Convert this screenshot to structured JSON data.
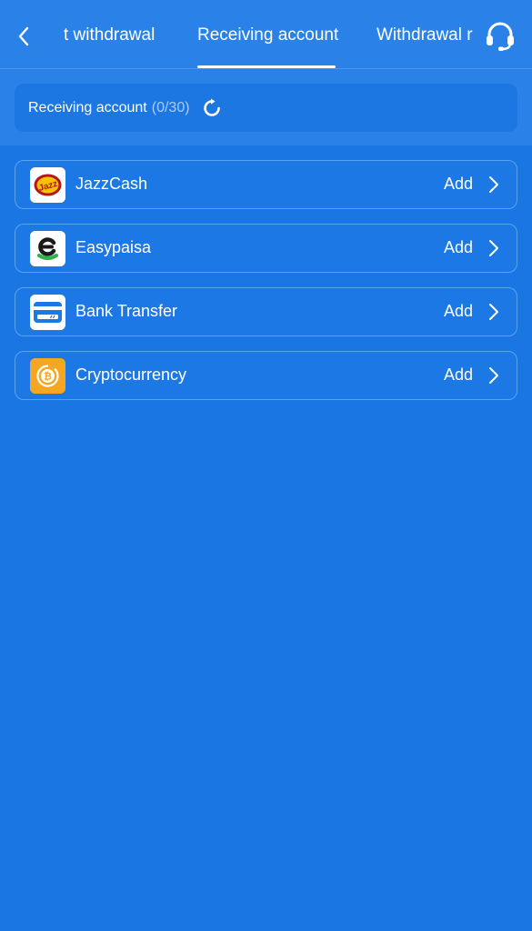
{
  "header": {
    "tabs": [
      {
        "label": "t withdrawal"
      },
      {
        "label": "Receiving account"
      },
      {
        "label": "Withdrawal r"
      }
    ],
    "active_tab": 1
  },
  "summary": {
    "label": "Receiving account",
    "count": "(0/30)"
  },
  "accounts": [
    {
      "label": "JazzCash",
      "action": "Add",
      "icon": "jazzcash-logo"
    },
    {
      "label": "Easypaisa",
      "action": "Add",
      "icon": "easypaisa-logo"
    },
    {
      "label": "Bank Transfer",
      "action": "Add",
      "icon": "bank-card-icon"
    },
    {
      "label": "Cryptocurrency",
      "action": "Add",
      "icon": "bitcoin-icon"
    }
  ],
  "colors": {
    "background": "#1a76e2",
    "header": "#2a82e8",
    "border": "#5aa3f0",
    "muted_text": "#a9cdf6",
    "crypto_orange": "#f5a623"
  }
}
